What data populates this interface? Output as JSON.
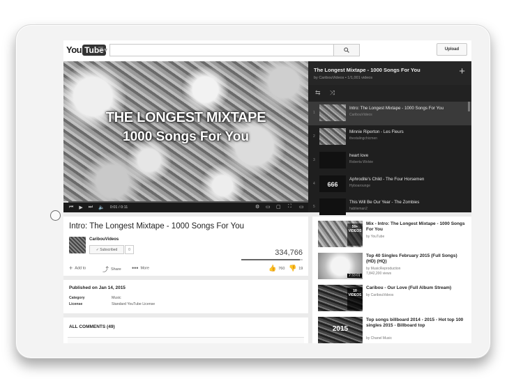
{
  "header": {
    "logo_you": "You",
    "logo_tube": "Tube",
    "search_placeholder": "",
    "upload_label": "Upload"
  },
  "player": {
    "overlay_line1": "THE LONGEST MIXTAPE",
    "overlay_line2": "1000 Songs For You",
    "time": "0:01 / 0:11"
  },
  "playlist": {
    "title": "The Longest Mixtape - 1000 Songs For You",
    "subtitle": "by CaribouVideos • 1/1,001 videos",
    "items": [
      {
        "num": "1",
        "title": "Intro: The Longest Mixtape - 1000 Songs For You",
        "by": "CaribouVideos",
        "thumb_text": ""
      },
      {
        "num": "2",
        "title": "Minnie Riperton - Les Fleurs",
        "by": "thestalingchicmen",
        "thumb_text": ""
      },
      {
        "num": "3",
        "title": "heart love",
        "by": "Roberta Wolvie",
        "thumb_text": ""
      },
      {
        "num": "4",
        "title": "Aphrodite's Child - The Four Horsemen",
        "by": "Hyboarounge",
        "thumb_text": "666"
      },
      {
        "num": "5",
        "title": "This Will Be Our Year - The Zombies",
        "by": "hablieman2",
        "thumb_text": ""
      }
    ]
  },
  "video": {
    "title": "Intro: The Longest Mixtape - 1000 Songs For You",
    "channel": "CaribouVideos",
    "subscribe_label": "✓ Subscribed",
    "sub_count": "0",
    "views": "334,766",
    "add_to": "Add to",
    "share": "Share",
    "more": "More",
    "likes": "760",
    "dislikes": "19",
    "view_fraction": 0.95
  },
  "details": {
    "published": "Published on Jan 14, 2015",
    "category_label": "Category",
    "category_value": "Music",
    "license_label": "License",
    "license_value": "Standard YouTube License"
  },
  "comments": {
    "title": "ALL COMMENTS (49)"
  },
  "related": [
    {
      "title": "Mix - Intro: The Longest Mixtape - 1000 Songs For You",
      "by": "by YouTube",
      "views": "",
      "overlay": "50+\nVIDEOS",
      "duration": ""
    },
    {
      "title": "Top 40 Singles February 2015 (Full Songs) (HD) (HQ)",
      "by": "by MusicReproduction",
      "views": "7,842,200 views",
      "overlay": "",
      "duration": "2:33:01"
    },
    {
      "title": "Caribou - Our Love (Full Album Stream)",
      "by": "by CaribouVideos",
      "views": "",
      "overlay": "10\nVIDEOS",
      "duration": ""
    },
    {
      "title": "Top songs billboard 2014 - 2015 - Hot top 100 singles 2015 - Billboard top",
      "by": "by Chanel Music",
      "views": "",
      "overlay": "2015",
      "duration": ""
    }
  ],
  "icons": {
    "menu": "hamburger-icon",
    "search": "search-icon",
    "add": "plus-icon",
    "shuffle": "shuffle-icon",
    "loop": "loop-icon"
  }
}
